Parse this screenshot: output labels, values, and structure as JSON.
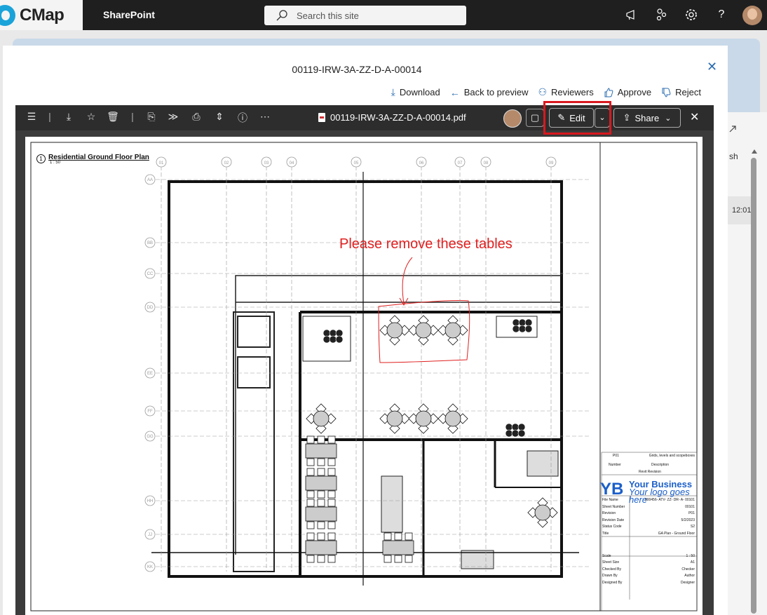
{
  "topbar": {
    "logo_text": "CMap",
    "app_name": "SharePoint",
    "search_placeholder": "Search this site"
  },
  "background": {
    "right_text_1": "sh",
    "right_text_2": "12:01"
  },
  "modal": {
    "title": "00119-IRW-3A-ZZ-D-A-00014",
    "actions": {
      "download": "Download",
      "back_to_preview": "Back to preview",
      "reviewers": "Reviewers",
      "approve": "Approve",
      "reject": "Reject"
    }
  },
  "viewer": {
    "filename": "00119-IRW-3A-ZZ-D-A-00014.pdf",
    "edit_label": "Edit",
    "share_label": "Share"
  },
  "drawing": {
    "title": "Residential Ground Floor Plan",
    "scale": "1 : 50",
    "view_number": "1",
    "annotation": "Please remove these tables",
    "grid_columns": [
      "01",
      "02",
      "03",
      "04",
      "05",
      "06",
      "07",
      "08",
      "09"
    ],
    "grid_rows": [
      "AA",
      "BB",
      "CC",
      "DD",
      "EE",
      "FF",
      "GG",
      "HH",
      "JJ",
      "KK"
    ],
    "title_block": {
      "revision_row": [
        "P01",
        "Grids, levels and scopeboxes"
      ],
      "header_row": [
        "Number",
        "Description"
      ],
      "revit_revision": "Revit Revision",
      "logo_letters": "YB",
      "business": "Your Business",
      "tagline": "Your logo goes here",
      "fields": [
        [
          "File Name",
          "000456- ATV- ZZ- DR- A- 00101"
        ],
        [
          "Sheet Number",
          "00101"
        ],
        [
          "Revision",
          "P01"
        ],
        [
          "Revision Date",
          "5/2/2023"
        ],
        [
          "Status Code",
          "S2"
        ],
        [
          "Title",
          "GA Plan - Ground Floor"
        ],
        [
          "Scale",
          "1 : 50"
        ],
        [
          "Sheet Size",
          "A1"
        ],
        [
          "Checked By",
          "Checker"
        ],
        [
          "Drawn By",
          "Author"
        ],
        [
          "Designed By",
          "Designer"
        ]
      ]
    }
  },
  "colors": {
    "topbar": "#1f1f1f",
    "accent": "#2b6cb0",
    "annotation": "#e02020",
    "highlight_box": "#d9181f",
    "logo_blue": "#1b5fc9"
  }
}
